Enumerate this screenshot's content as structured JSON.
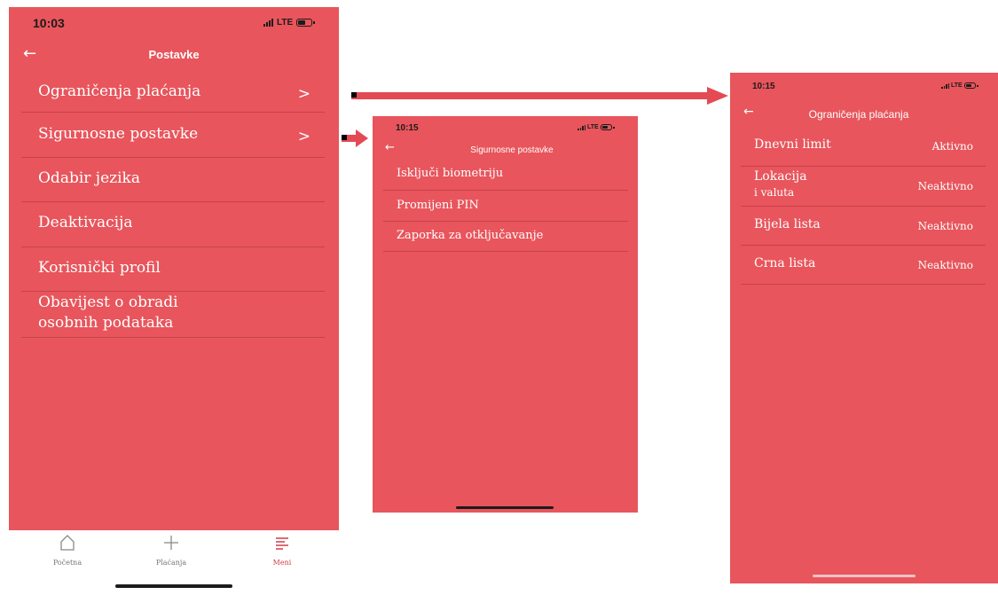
{
  "screen1": {
    "time": "10:03",
    "network": "LTE",
    "title": "Postavke",
    "items": [
      {
        "label": "Ograničenja plaćanja"
      },
      {
        "label": "Sigurnosne postavke"
      },
      {
        "label": "Odabir jezika"
      },
      {
        "label": "Deaktivacija"
      },
      {
        "label": "Korisnički profil"
      },
      {
        "label_line1": "Obavijest o obradi",
        "label_line2": "osobnih podataka"
      }
    ],
    "tabs": [
      {
        "label": "Početna",
        "icon": "home-icon"
      },
      {
        "label": "Plaćanja",
        "icon": "plus-icon"
      },
      {
        "label": "Meni",
        "icon": "menu-icon"
      }
    ]
  },
  "screen2": {
    "time": "10:15",
    "network": "LTE",
    "title": "Sigurnosne postavke",
    "items": [
      {
        "label": "Isključi biometriju"
      },
      {
        "label": "Promijeni PIN"
      },
      {
        "label": "Zaporka za otključavanje"
      }
    ]
  },
  "screen3": {
    "time": "10:15",
    "network": "LTE",
    "title": "Ograničenja plaćanja",
    "items": [
      {
        "label": "Dnevni limit",
        "status": "Aktivno"
      },
      {
        "label_line1": "Lokacija",
        "label_line2": "i valuta",
        "status": "Neaktivno"
      },
      {
        "label": "Bijela lista",
        "status": "Neaktivno"
      },
      {
        "label": "Crna lista",
        "status": "Neaktivno"
      }
    ]
  },
  "colors": {
    "accent": "#e8555c",
    "arrow": "#e44a53"
  }
}
